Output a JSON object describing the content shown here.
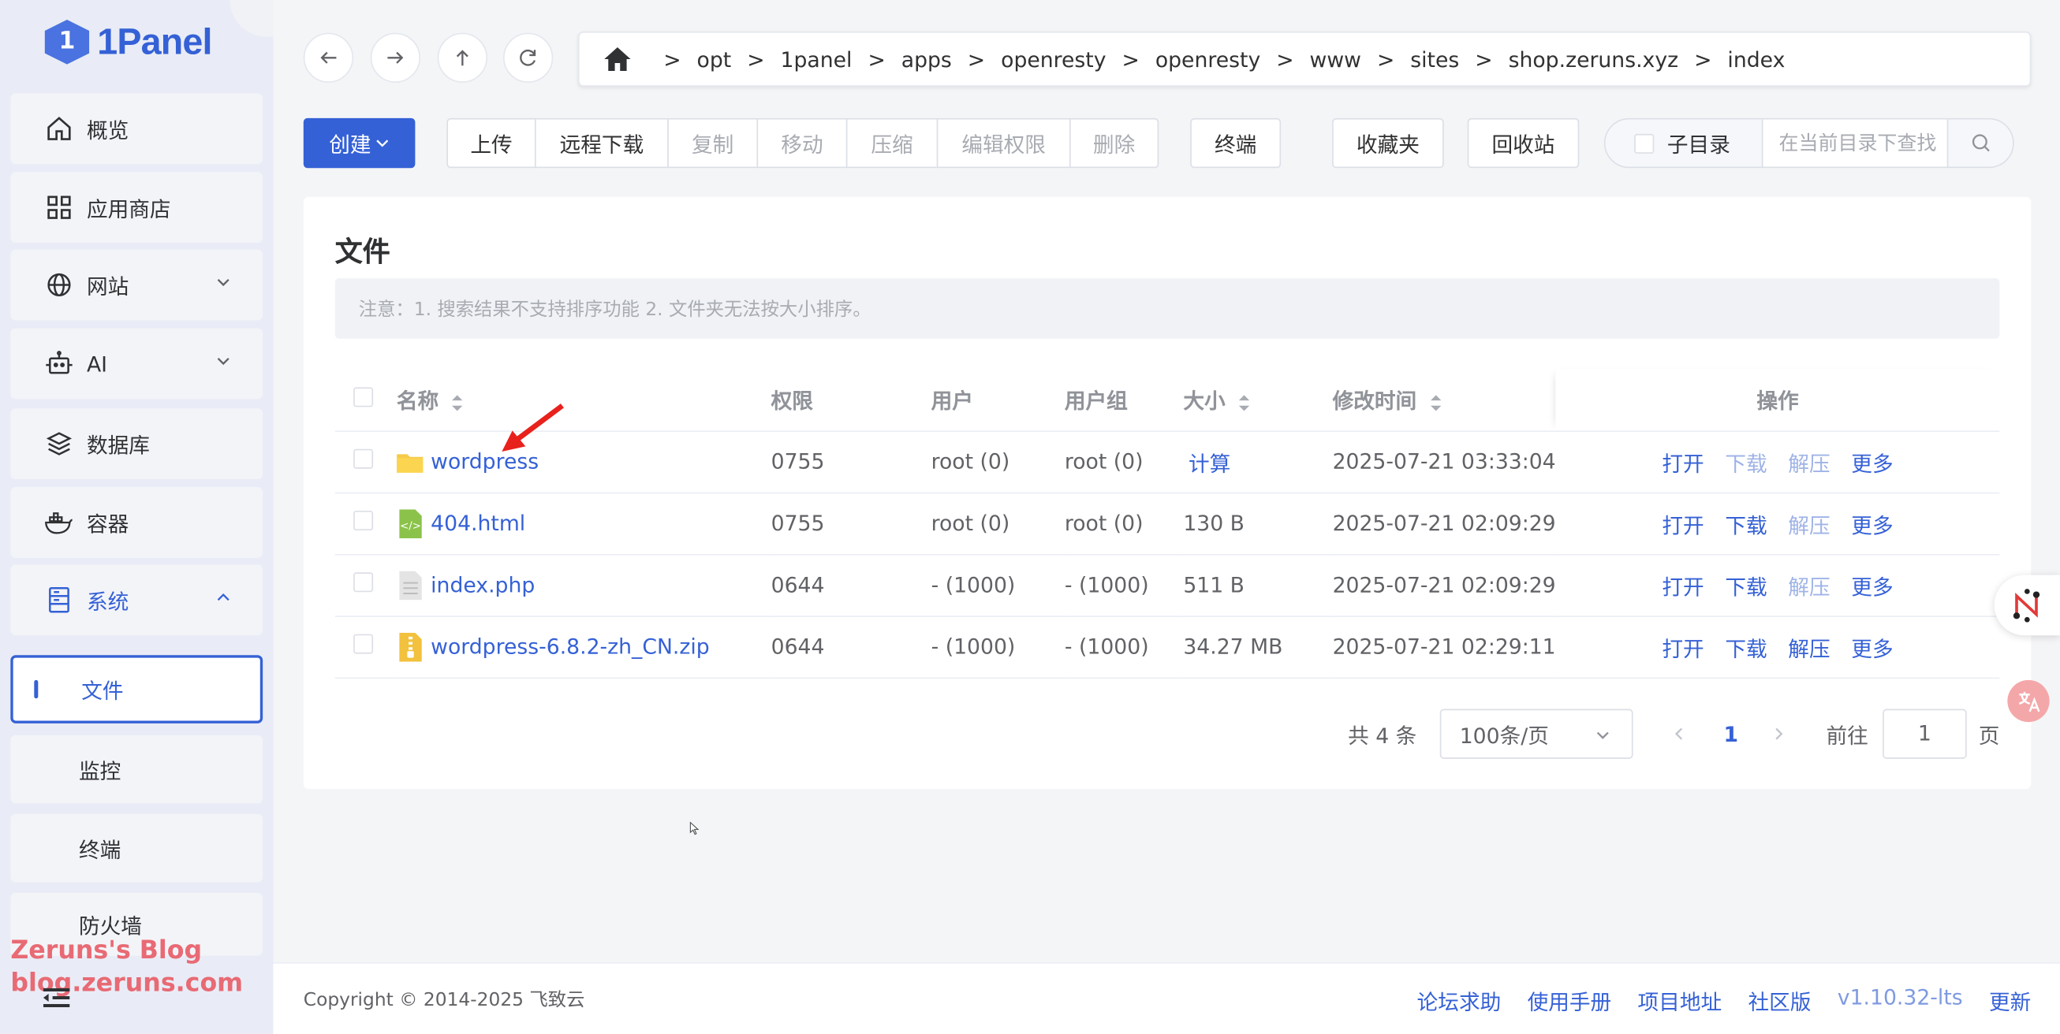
{
  "app": {
    "logo_text": "1Panel",
    "logo_badge": "1"
  },
  "sidebar": {
    "items": [
      {
        "label": "概览",
        "icon": "home-icon"
      },
      {
        "label": "应用商店",
        "icon": "apps-grid-icon"
      },
      {
        "label": "网站",
        "icon": "globe-icon"
      },
      {
        "label": "AI",
        "icon": "robot-icon"
      },
      {
        "label": "数据库",
        "icon": "database-layers-icon"
      },
      {
        "label": "容器",
        "icon": "docker-icon"
      },
      {
        "label": "系统",
        "icon": "server-icon"
      }
    ],
    "sub_items": [
      {
        "label": "文件"
      },
      {
        "label": "监控"
      },
      {
        "label": "终端"
      },
      {
        "label": "防火墙"
      }
    ]
  },
  "watermark": {
    "line1": "Zeruns's Blog",
    "line2": "blog.zeruns.com"
  },
  "breadcrumb": [
    "opt",
    "1panel",
    "apps",
    "openresty",
    "openresty",
    "www",
    "sites",
    "shop.zeruns.xyz",
    "index"
  ],
  "breadcrumb_sep": ">",
  "toolbar": {
    "create": "创建",
    "upload": "上传",
    "remote_download": "远程下载",
    "copy": "复制",
    "move": "移动",
    "compress": "压缩",
    "edit_permission": "编辑权限",
    "delete": "删除",
    "terminal": "终端",
    "favorites": "收藏夹",
    "recycle_bin": "回收站",
    "subdir": "子目录",
    "search_placeholder": "在当前目录下查找"
  },
  "card": {
    "title": "文件",
    "notice": "注意：1. 搜索结果不支持排序功能 2. 文件夹无法按大小排序。"
  },
  "table": {
    "headers": {
      "name": "名称",
      "perm": "权限",
      "user": "用户",
      "group": "用户组",
      "size": "大小",
      "mtime": "修改时间",
      "ops": "操作"
    },
    "rows": [
      {
        "name": "wordpress",
        "icon": "folder-icon",
        "perm": "0755",
        "user": "root (0)",
        "group": "root (0)",
        "size": "计算",
        "mtime": "2025-07-21 03:33:04"
      },
      {
        "name": "404.html",
        "icon": "html-file-icon",
        "perm": "0755",
        "user": "root (0)",
        "group": "root (0)",
        "size": "130 B",
        "mtime": "2025-07-21 02:09:29"
      },
      {
        "name": "index.php",
        "icon": "text-file-icon",
        "perm": "0644",
        "user": "- (1000)",
        "group": "- (1000)",
        "size": "511 B",
        "mtime": "2025-07-21 02:09:29"
      },
      {
        "name": "wordpress-6.8.2-zh_CN.zip",
        "icon": "zip-file-icon",
        "perm": "0644",
        "user": "- (1000)",
        "group": "- (1000)",
        "size": "34.27 MB",
        "mtime": "2025-07-21 02:29:11"
      }
    ],
    "ops": {
      "open": "打开",
      "download": "下载",
      "extract": "解压",
      "more": "更多"
    }
  },
  "pagination": {
    "total": "共 4 条",
    "page_size": "100条/页",
    "current": "1",
    "goto_label": "前往",
    "goto_value": "1",
    "page_suffix": "页"
  },
  "footer": {
    "copyright": "Copyright © 2014-2025 飞致云",
    "links": [
      "论坛求助",
      "使用手册",
      "项目地址",
      "社区版"
    ],
    "version": "v1.10.32-lts",
    "update": "更新"
  },
  "colors": {
    "primary": "#3561d6",
    "sidebar_bg": "#e9ecf6",
    "page_bg": "#f4f5f7"
  }
}
